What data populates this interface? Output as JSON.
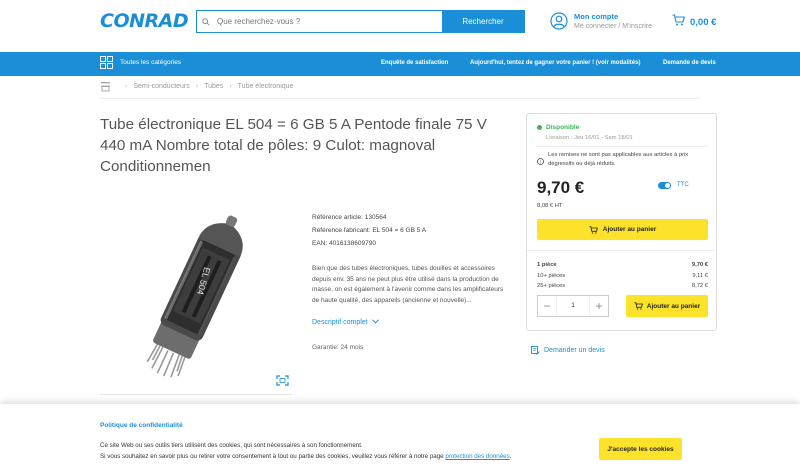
{
  "header": {
    "logo": "CONRAD",
    "search_placeholder": "Que recherchez-vous ?",
    "search_button": "Rechercher",
    "account_title": "Mon compte",
    "account_sub": "Me connecter / M'inscrire",
    "cart_amount": "0,00 €"
  },
  "nav": {
    "categories": "Toutes les catégories",
    "links": [
      "Enquête de satisfaction",
      "Aujourd'hui, tentez de gagner votre panier ! (voir modalités)",
      "Demande de devis"
    ]
  },
  "breadcrumb": [
    "Semi-conducteurs",
    "Tubes",
    "Tube électronique"
  ],
  "product": {
    "title": "Tube électronique EL 504 = 6 GB 5 A Pentode finale 75 V 440 mA Nombre total de pôles: 9 Culot: magnoval Conditionnemen",
    "image_label": "EL 504",
    "specs": [
      "Référence article: 130564",
      "Référence fabricant: EL 504 = 6 GB 5 A",
      "EAN: 4016138609790"
    ],
    "description": "Bien que des tubes électroniques, tubes douilles et accessoires depuis env. 35 ans ne peut plus être utilisé dans la production de masse, on est également à l'avenir comme dans les amplificateurs de haute qualité, des appareils (ancienne et nouvelle)...",
    "description_link": "Descriptif complet",
    "guarantee": "Garantie: 24 mois"
  },
  "buybox": {
    "availability": "Disponible",
    "delivery": "Livraison : Jeu 16/01 - Sam 18/01",
    "notice": "Les remises ne sont pas applicables aux articles à prix dégressifs ou déjà réduits.",
    "price": "9,70 €",
    "price_ht": "8,08 € HT",
    "toggle_label": "TTC",
    "add_to_cart": "Ajouter au panier",
    "tiers": [
      {
        "qty": "1 pièce",
        "price": "9,70 €"
      },
      {
        "qty": "10+ pièces",
        "price": "9,11 €"
      },
      {
        "qty": "25+ pièces",
        "price": "8,72 €"
      }
    ],
    "quantity": "1",
    "minus": "−",
    "plus": "+",
    "add_to_cart_2": "Ajouter au panier"
  },
  "quote_link": "Demander un devis",
  "cookie": {
    "title": "Politique de confidentialité",
    "line1": "Ce site Web ou ses outils tiers utilisent des cookies, qui sont nécessaires à son fonctionnement.",
    "line2": "Si vous souhaitez en savoir plus ou retirer votre consentement à tout ou partie des cookies, veuillez vous référer à notre page",
    "link": "protection des données",
    "line2_end": ".",
    "accept": "J'accepte les cookies"
  },
  "colors": {
    "brand_blue": "#1a8fd8",
    "cta_yellow": "#fce22b",
    "available_green": "#3db556"
  }
}
